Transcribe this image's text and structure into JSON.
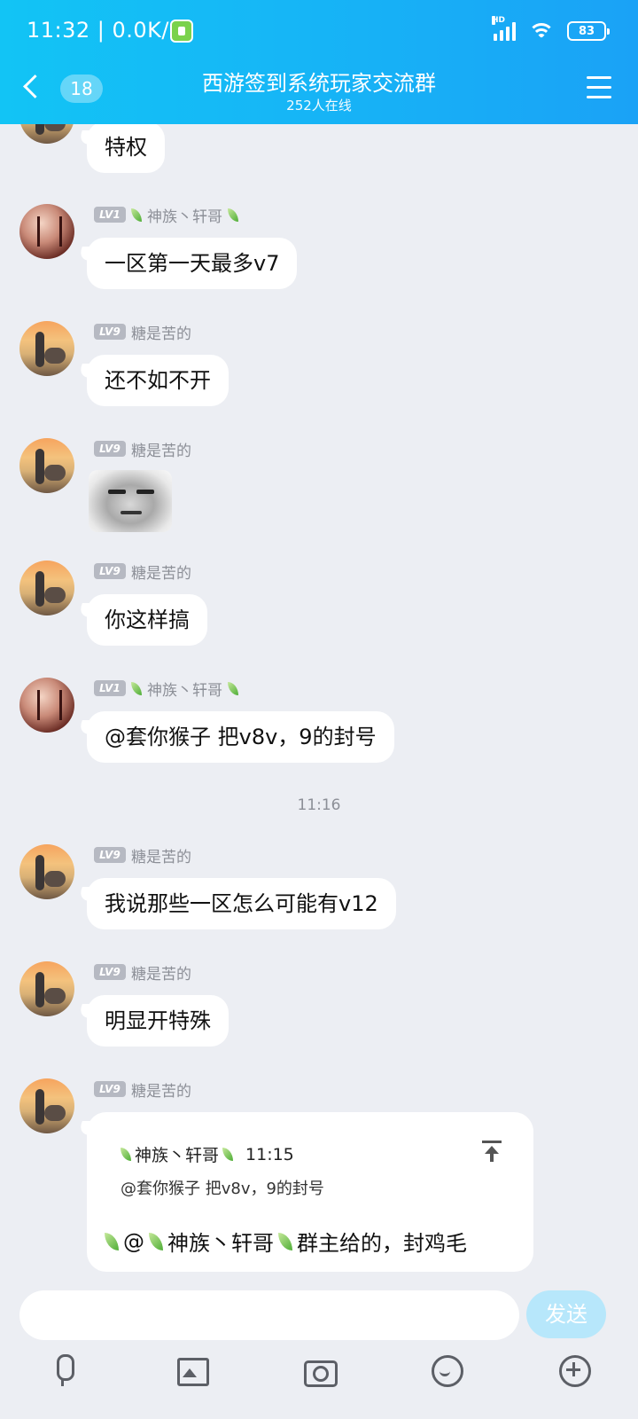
{
  "status_bar": {
    "time_speed": "11:32 | 0.0K/s",
    "network": "HD",
    "battery": "83"
  },
  "header": {
    "unread_count": "18",
    "group_name": "西游签到系统玩家交流群",
    "online": "252人在线"
  },
  "messages": [
    {
      "text": "特权"
    },
    {
      "level": "LV1",
      "sender": "神族丶轩哥",
      "text": "一区第一天最多v7"
    },
    {
      "level": "LV9",
      "sender": "糖是苦的",
      "text": "还不如不开"
    },
    {
      "level": "LV9",
      "sender": "糖是苦的",
      "sticker": "meme-face-sticker"
    },
    {
      "level": "LV9",
      "sender": "糖是苦的",
      "text": "你这样搞"
    },
    {
      "level": "LV1",
      "sender": "神族丶轩哥",
      "text": "@套你猴子 把v8v，9的封号"
    },
    {
      "level": "LV9",
      "sender": "糖是苦的",
      "text": "我说那些一区怎么可能有v12"
    },
    {
      "level": "LV9",
      "sender": "糖是苦的",
      "text": "明显开特殊"
    },
    {
      "level": "LV9",
      "sender": "糖是苦的",
      "quote": {
        "sender": "神族丶轩哥",
        "time": "11:15",
        "text": "@套你猴子 把v8v，9的封号"
      },
      "mention": "@",
      "mention_name": "神族丶轩哥",
      "text": "群主给的，封鸡毛"
    }
  ],
  "timestamp": "11:16",
  "input": {
    "placeholder": "",
    "send_label": "发送"
  },
  "toolbar": [
    "microphone-icon",
    "image-icon",
    "camera-icon",
    "emoji-icon",
    "plus-icon"
  ],
  "colors": {
    "header_start": "#12c4f5",
    "header_end": "#1aa2f6",
    "send_button": "#b7e7fb",
    "background": "#eceef3"
  }
}
